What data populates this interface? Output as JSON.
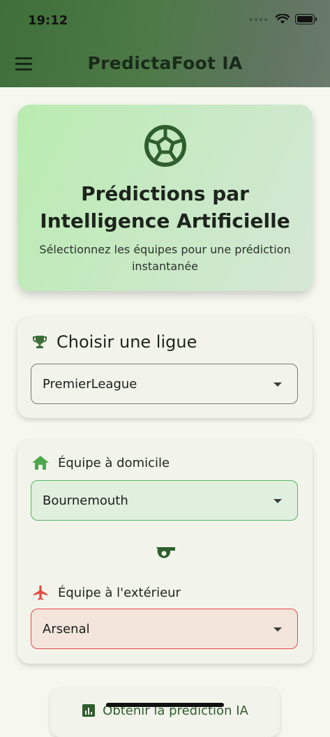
{
  "status_bar": {
    "time": "19:12"
  },
  "app_bar": {
    "title": "PredictaFoot IA"
  },
  "hero": {
    "title_line1": "Prédictions par",
    "title_line2": "Intelligence Artificielle",
    "subtitle": "Sélectionnez les équipes pour une prédiction instantanée"
  },
  "league": {
    "title": "Choisir une ligue",
    "selected": "PremierLeague"
  },
  "teams": {
    "home_label": "Équipe à domicile",
    "home_selected": "Bournemouth",
    "away_label": "Équipe à l'extérieur",
    "away_selected": "Arsenal"
  },
  "actions": {
    "predict_label": "Obtenir la prédiction IA"
  },
  "colors": {
    "primary": "#3f6f3a",
    "home_accent": "#58b55a",
    "away_accent": "#e54b45"
  },
  "icons": [
    "menu-icon",
    "refresh-icon",
    "soccer-ball-icon",
    "trophy-icon",
    "home-icon",
    "whistle-icon",
    "airplane-icon",
    "chart-icon",
    "wifi-icon",
    "battery-icon",
    "chevron-down-icon"
  ]
}
